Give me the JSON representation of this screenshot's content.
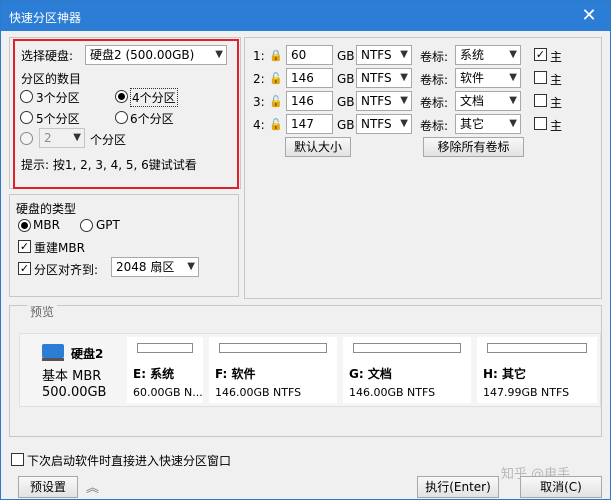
{
  "window": {
    "title": "快速分区神器",
    "close_glyph": "✕"
  },
  "disk_select": {
    "label": "选择硬盘:",
    "value": "硬盘2 (500.00GB)"
  },
  "count_group": {
    "title": "分区的数目",
    "options": [
      "3个分区",
      "4个分区",
      "5个分区",
      "6个分区"
    ],
    "selected": "4个分区",
    "custom_value": "2",
    "custom_suffix": "个分区",
    "hint": "提示: 按1, 2, 3, 4, 5, 6键试试看"
  },
  "disk_type": {
    "title": "硬盘的类型",
    "mbr": "MBR",
    "gpt": "GPT",
    "selected": "MBR",
    "rebuild_mbr": "重建MBR",
    "align_label": "分区对齐到:",
    "align_value": "2048 扇区"
  },
  "partitions": [
    {
      "index": "1:",
      "size": "60",
      "unit": "GB",
      "fs": "NTFS",
      "label_caption": "卷标:",
      "label": "系统",
      "primary": true,
      "primary_caption": "主"
    },
    {
      "index": "2:",
      "size": "146",
      "unit": "GB",
      "fs": "NTFS",
      "label_caption": "卷标:",
      "label": "软件",
      "primary": false,
      "primary_caption": "主"
    },
    {
      "index": "3:",
      "size": "146",
      "unit": "GB",
      "fs": "NTFS",
      "label_caption": "卷标:",
      "label": "文档",
      "primary": false,
      "primary_caption": "主"
    },
    {
      "index": "4:",
      "size": "147",
      "unit": "GB",
      "fs": "NTFS",
      "label_caption": "卷标:",
      "label": "其它",
      "primary": false,
      "primary_caption": "主"
    }
  ],
  "buttons": {
    "default_size": "默认大小",
    "remove_labels": "移除所有卷标",
    "preset": "预设置",
    "execute": "执行(Enter)",
    "cancel": "取消(C)"
  },
  "preview": {
    "title": "预览",
    "disk_name": "硬盘2",
    "disk_style": "基本 MBR",
    "disk_size": "500.00GB",
    "parts": [
      {
        "name": "E: 系统",
        "size": "60.00GB N..."
      },
      {
        "name": "F: 软件",
        "size": "146.00GB NTFS"
      },
      {
        "name": "G: 文档",
        "size": "146.00GB NTFS"
      },
      {
        "name": "H: 其它",
        "size": "147.99GB NTFS"
      }
    ]
  },
  "startup_checkbox": "下次启动软件时直接进入快速分区窗口",
  "watermark": "知乎 @电手",
  "colors": {
    "titlebar": "#2b7dd6",
    "highlight_border": "#e0202a"
  },
  "icons": {
    "close": "close-icon",
    "lock": "lock-icon",
    "unlock": "unlock-icon",
    "disk": "disk-icon",
    "collapse": "double-chevron-up-icon"
  }
}
